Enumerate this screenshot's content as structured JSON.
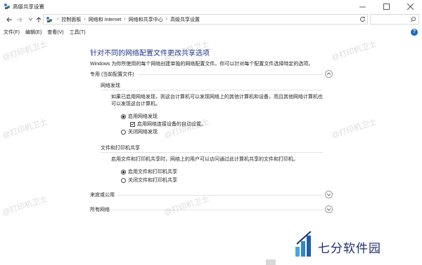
{
  "window": {
    "title": "高级共享设置",
    "minimize_glyph": "—",
    "maximize_glyph": "☐",
    "close_glyph": "✕"
  },
  "address": {
    "crumbs": [
      "控制面板",
      "网络和 Internet",
      "网络和共享中心",
      "高级共享设置"
    ]
  },
  "menu": {
    "items": [
      "文件(F)",
      "编辑(E)",
      "查看(V)",
      "工具(T)"
    ],
    "help": "?"
  },
  "main": {
    "title": "针对不同的网络配置文件更改共享选项",
    "description": "Windows 为你所使用的每个网络创建单独的网络配置文件。你可以针对每个配置文件选择特定的选项。",
    "private_profile": {
      "label": "专用 (当前配置文件)",
      "discovery": {
        "title": "网络发现",
        "text_line1": "如果已启用网络发现，则这台计算机可以发现网络上的其他计算机和设备，而且其他网络计算机也",
        "text_line2": "可以发现这台计算机。",
        "on_label": "启用网络发现",
        "auto_label": "启用网络连接设备的自动设置。",
        "off_label": "关闭网络发现"
      },
      "sharing": {
        "title": "文件和打印机共享",
        "text": "启用文件和打印机共享时，网络上的用户可以访问通过此计算机共享的文件和打印机。",
        "on_label": "启用文件和打印机共享",
        "off_label": "关闭文件和打印机共享"
      }
    },
    "guest_profile": {
      "label": "来宾或公用"
    },
    "all_profile": {
      "label": "所有网络"
    }
  },
  "watermark": "@打印机卫士",
  "brand": {
    "name": "七分软件园"
  },
  "colors": {
    "title_blue": "#1e3287",
    "accent_blue": "#1e67c4",
    "logo_blue": "#1f2f6e",
    "logo_cyan": "#3fa9e0"
  }
}
